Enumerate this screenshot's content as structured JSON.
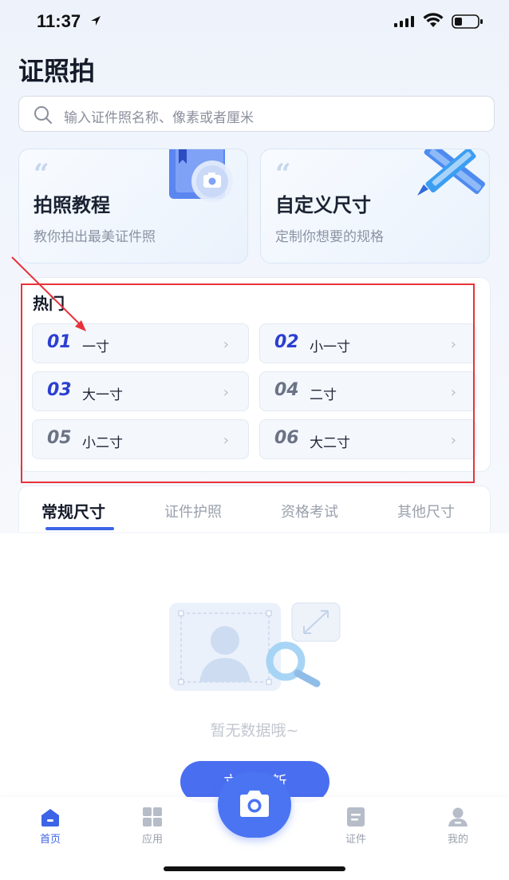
{
  "status_bar": {
    "time": "11:37"
  },
  "header": {
    "title": "证照拍"
  },
  "search": {
    "placeholder": "输入证件照名称、像素或者厘米"
  },
  "feature_cards": [
    {
      "title": "拍照教程",
      "subtitle": "教你拍出最美证件照"
    },
    {
      "title": "自定义尺寸",
      "subtitle": "定制你想要的规格"
    }
  ],
  "hot": {
    "title": "热门",
    "items": [
      {
        "num": "01",
        "label": "一寸"
      },
      {
        "num": "02",
        "label": "小一寸"
      },
      {
        "num": "03",
        "label": "大一寸"
      },
      {
        "num": "04",
        "label": "二寸"
      },
      {
        "num": "05",
        "label": "小二寸"
      },
      {
        "num": "06",
        "label": "大二寸"
      }
    ]
  },
  "tabs": [
    {
      "label": "常规尺寸",
      "active": true
    },
    {
      "label": "证件护照",
      "active": false
    },
    {
      "label": "资格考试",
      "active": false
    },
    {
      "label": "其他尺寸",
      "active": false
    }
  ],
  "empty_state": {
    "message": "暂无数据哦~",
    "refresh_label": "立即刷新"
  },
  "bottom_nav": [
    {
      "label": "首页",
      "icon": "home-icon",
      "active": true
    },
    {
      "label": "应用",
      "icon": "apps-icon",
      "active": false
    },
    {
      "label": "证件",
      "icon": "document-icon",
      "active": false
    },
    {
      "label": "我的",
      "icon": "profile-icon",
      "active": false
    }
  ],
  "colors": {
    "accent": "#4a6ef0",
    "hot_number_blue": "#2b3fd1",
    "annotation_red": "#e8323a"
  }
}
